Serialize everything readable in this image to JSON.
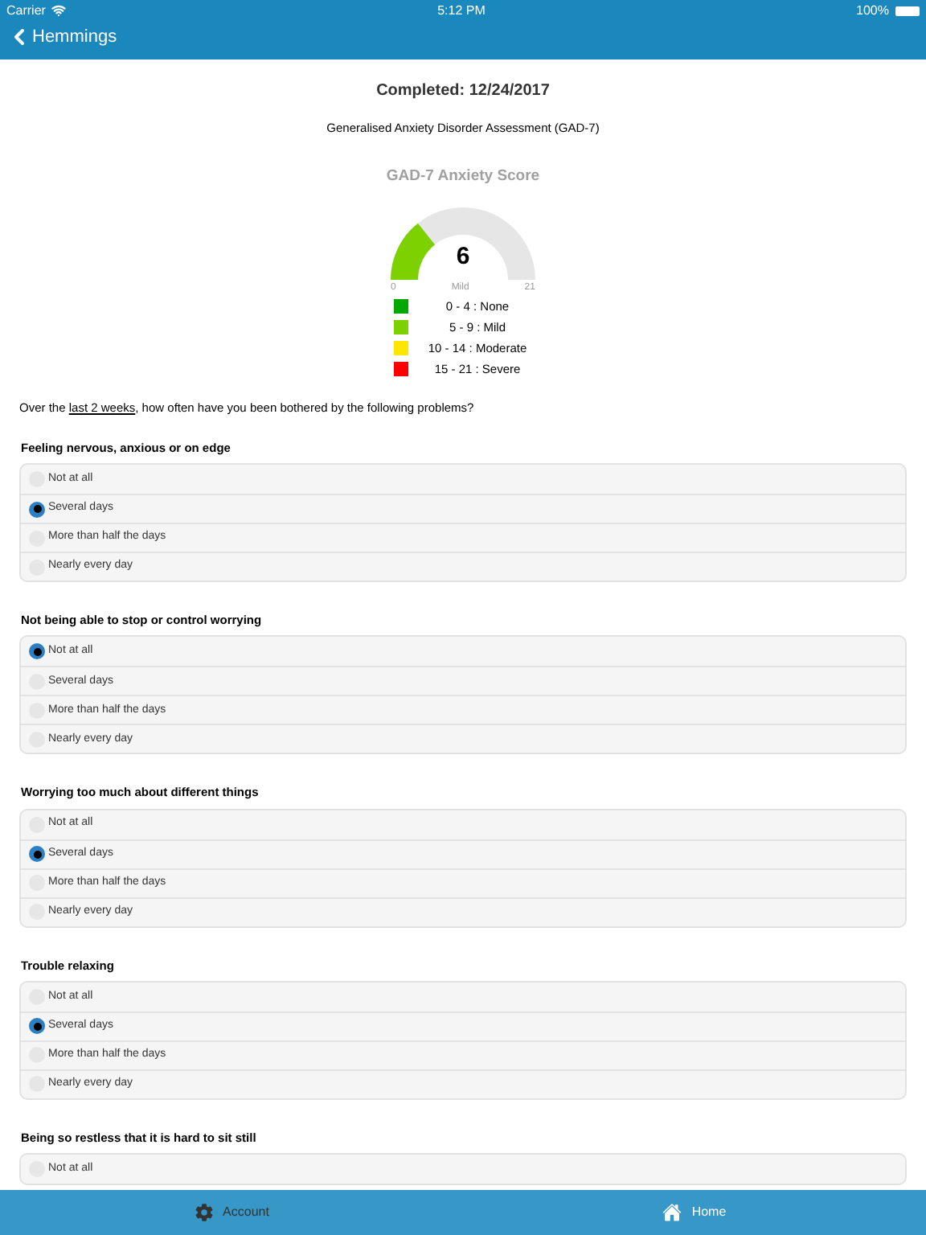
{
  "status_bar": {
    "carrier": "Carrier",
    "time": "5:12 PM",
    "battery": "100%"
  },
  "nav": {
    "back": "Hemmings"
  },
  "completed": "Completed: 12/24/2017",
  "assessment": "Generalised Anxiety Disorder Assessment (GAD-7)",
  "gauge": {
    "title": "GAD-7 Anxiety Score",
    "value": "6",
    "band": "Mild",
    "min": "0",
    "max": "21",
    "level": 0.2857,
    "color": "#7ed100"
  },
  "legend": [
    {
      "label": "0 - 4 : None",
      "color": "#00a800"
    },
    {
      "label": "5 - 9 : Mild",
      "color": "#7ed100"
    },
    {
      "label": "10 - 14 : Moderate",
      "color": "#ffe600"
    },
    {
      "label": "15 - 21 : Severe",
      "color": "#ff0000"
    }
  ],
  "prompt": {
    "before": "Over the ",
    "underlined": "last 2 weeks",
    "after": ", how often have you been bothered by the following problems?"
  },
  "questions": [
    {
      "title": "Feeling nervous, anxious or on edge",
      "options": [
        {
          "label": "Not at all",
          "selected": false
        },
        {
          "label": "Several days",
          "selected": true
        },
        {
          "label": "More than half the days",
          "selected": false
        },
        {
          "label": "Nearly every day",
          "selected": false
        }
      ]
    },
    {
      "title": "Not being able to stop or control worrying",
      "options": [
        {
          "label": "Not at all",
          "selected": true
        },
        {
          "label": "Several days",
          "selected": false
        },
        {
          "label": "More than half the days",
          "selected": false
        },
        {
          "label": "Nearly every day",
          "selected": false
        }
      ]
    },
    {
      "title": "Worrying too much about different things",
      "options": [
        {
          "label": "Not at all",
          "selected": false
        },
        {
          "label": "Several days",
          "selected": true
        },
        {
          "label": "More than half the days",
          "selected": false
        },
        {
          "label": "Nearly every day",
          "selected": false
        }
      ]
    },
    {
      "title": "Trouble relaxing",
      "options": [
        {
          "label": "Not at all",
          "selected": false
        },
        {
          "label": "Several days",
          "selected": true
        },
        {
          "label": "More than half the days",
          "selected": false
        },
        {
          "label": "Nearly every day",
          "selected": false
        }
      ]
    },
    {
      "title": "Being so restless that it is hard to sit still",
      "options": [
        {
          "label": "Not at all",
          "selected": false
        }
      ]
    }
  ],
  "tabs": [
    {
      "label": "Account",
      "kind": "gear",
      "selected": false
    },
    {
      "label": "Home",
      "kind": "home",
      "selected": true
    }
  ]
}
